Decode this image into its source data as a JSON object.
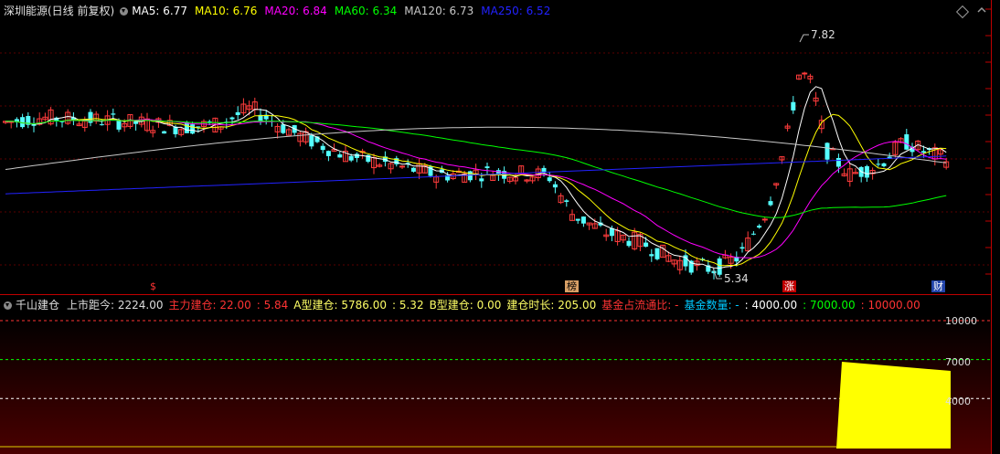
{
  "header": {
    "title": "深圳能源(日线 前复权)",
    "ma": [
      {
        "label": "MA5: 6.77",
        "color": "#ffffff"
      },
      {
        "label": "MA10: 6.76",
        "color": "#ffff00"
      },
      {
        "label": "MA20: 6.84",
        "color": "#ff00ff"
      },
      {
        "label": "MA60: 6.34",
        "color": "#00ff00"
      },
      {
        "label": "MA120: 6.73",
        "color": "#c8c8c8"
      },
      {
        "label": "MA250: 6.52",
        "color": "#2222ff"
      }
    ]
  },
  "price_chart": {
    "high_label": "7.82",
    "low_label": "5.34",
    "markers": [
      "$",
      "榜",
      "涨",
      "财"
    ]
  },
  "sub_header": {
    "title": "千山建仓",
    "items": [
      {
        "text": "上市距今: 2224.00",
        "color": "#dddddd"
      },
      {
        "text": "主力建仓: 22.00",
        "color": "#ff3333"
      },
      {
        "text": ": 5.84",
        "color": "#ff3333"
      },
      {
        "text": "A型建仓: 5786.00",
        "color": "#ffff66"
      },
      {
        "text": ": 5.32",
        "color": "#ffff66"
      },
      {
        "text": "B型建仓: 0.00",
        "color": "#ffff66"
      },
      {
        "text": "建仓时长: 205.00",
        "color": "#ffff66"
      },
      {
        "text": "基金占流通比: -",
        "color": "#ff3333"
      },
      {
        "text": "基金数量: -",
        "color": "#00c8ff"
      },
      {
        "text": ": 4000.00",
        "color": "#ffffff"
      },
      {
        "text": ": 7000.00",
        "color": "#00ff00"
      },
      {
        "text": ": 10000.00",
        "color": "#ff3333"
      }
    ]
  },
  "sub_axis": {
    "ticks": [
      "10000",
      "7000",
      "4000"
    ]
  }
}
